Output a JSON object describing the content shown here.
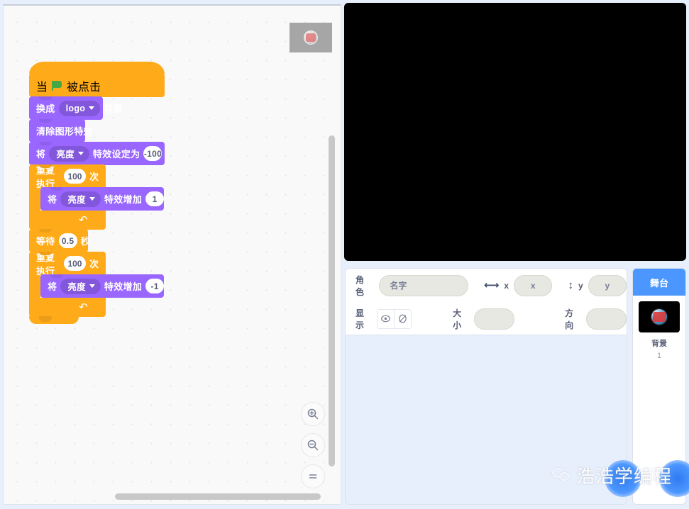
{
  "workspace": {
    "watermark_icon": "backdrop-thumbnail-watermark",
    "zoom_in_label": "zoom-in",
    "zoom_out_label": "zoom-out",
    "zoom_reset_label": "=",
    "script": {
      "blocks": [
        {
          "id": "hat",
          "type": "hat",
          "color": "#ffab19",
          "pre": "当",
          "icon": "green-flag",
          "post": "被点击"
        },
        {
          "id": "switch-backdrop",
          "type": "stack",
          "color": "#9966ff",
          "pre": "换成",
          "dropdown": "logo",
          "post": "背景"
        },
        {
          "id": "clear-effects",
          "type": "stack",
          "color": "#9966ff",
          "pre": "清除图形特效"
        },
        {
          "id": "set-effect",
          "type": "stack",
          "color": "#9966ff",
          "pre": "将",
          "dropdown": "亮度",
          "mid": "特效设定为",
          "value": "-100"
        },
        {
          "id": "repeat-1",
          "type": "c",
          "color": "#ffab19",
          "pre": "重复执行",
          "value": "100",
          "post": "次"
        },
        {
          "id": "change-effect-1",
          "type": "stack",
          "color": "#9966ff",
          "pre": "将",
          "dropdown": "亮度",
          "mid": "特效增加",
          "value": "1"
        },
        {
          "id": "wait",
          "type": "stack",
          "color": "#ffab19",
          "pre": "等待",
          "value": "0.5",
          "post": "秒"
        },
        {
          "id": "repeat-2",
          "type": "c",
          "color": "#ffab19",
          "pre": "重复执行",
          "value": "100",
          "post": "次"
        },
        {
          "id": "change-effect-2",
          "type": "stack",
          "color": "#9966ff",
          "pre": "将",
          "dropdown": "亮度",
          "mid": "特效增加",
          "value": "-1"
        }
      ]
    }
  },
  "stage": {
    "background_color": "#000000"
  },
  "sprite_info": {
    "sprite_label": "角色",
    "name_placeholder": "名字",
    "name_value": "",
    "x_label": "x",
    "x_value": "x",
    "y_label": "y",
    "y_value": "y",
    "show_label": "显示",
    "show_icon": "eye-icon",
    "hide_icon": "eye-slash-icon",
    "size_label": "大小",
    "size_value": "",
    "direction_label": "方向",
    "direction_value": "",
    "width_icon": "horizontal-arrows-icon",
    "height_icon": "vertical-arrows-icon"
  },
  "stage_selector": {
    "header": "舞台",
    "thumbnail_icon": "backdrop-logo-thumbnail",
    "label": "背景",
    "count": "1"
  },
  "watermark": {
    "icon": "wechat-icon",
    "text": "浩浩学编程"
  },
  "colors": {
    "looks_purple": "#9966ff",
    "control_orange": "#ffab19",
    "events_yellow": "#ffab19",
    "accent_blue": "#4c97ff",
    "panel_bg": "#e8effc"
  }
}
